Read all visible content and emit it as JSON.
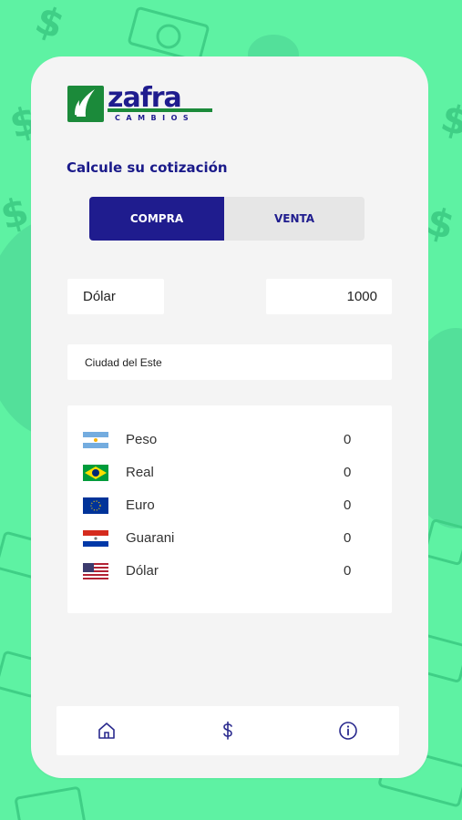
{
  "brand": {
    "name": "zafra",
    "tagline": "CAMBIOS",
    "colors": {
      "green": "#1b8a3a",
      "navy": "#1f1c8e",
      "background": "#5ef2a3"
    }
  },
  "calculator": {
    "title": "Calcule su cotización",
    "tabs": [
      {
        "label": "COMPRA",
        "active": true
      },
      {
        "label": "VENTA",
        "active": false
      }
    ],
    "currency": "Dólar",
    "amount": "1000",
    "city": "Ciudad del Este"
  },
  "results": [
    {
      "flag": "argentina-flag-icon",
      "name": "Peso",
      "value": "0"
    },
    {
      "flag": "brazil-flag-icon",
      "name": "Real",
      "value": "0"
    },
    {
      "flag": "eu-flag-icon",
      "name": "Euro",
      "value": "0"
    },
    {
      "flag": "paraguay-flag-icon",
      "name": "Guarani",
      "value": "0"
    },
    {
      "flag": "usa-flag-icon",
      "name": "Dólar",
      "value": "0"
    }
  ],
  "nav": {
    "items": [
      {
        "icon": "home-icon"
      },
      {
        "icon": "dollar-icon"
      },
      {
        "icon": "info-icon"
      }
    ]
  }
}
